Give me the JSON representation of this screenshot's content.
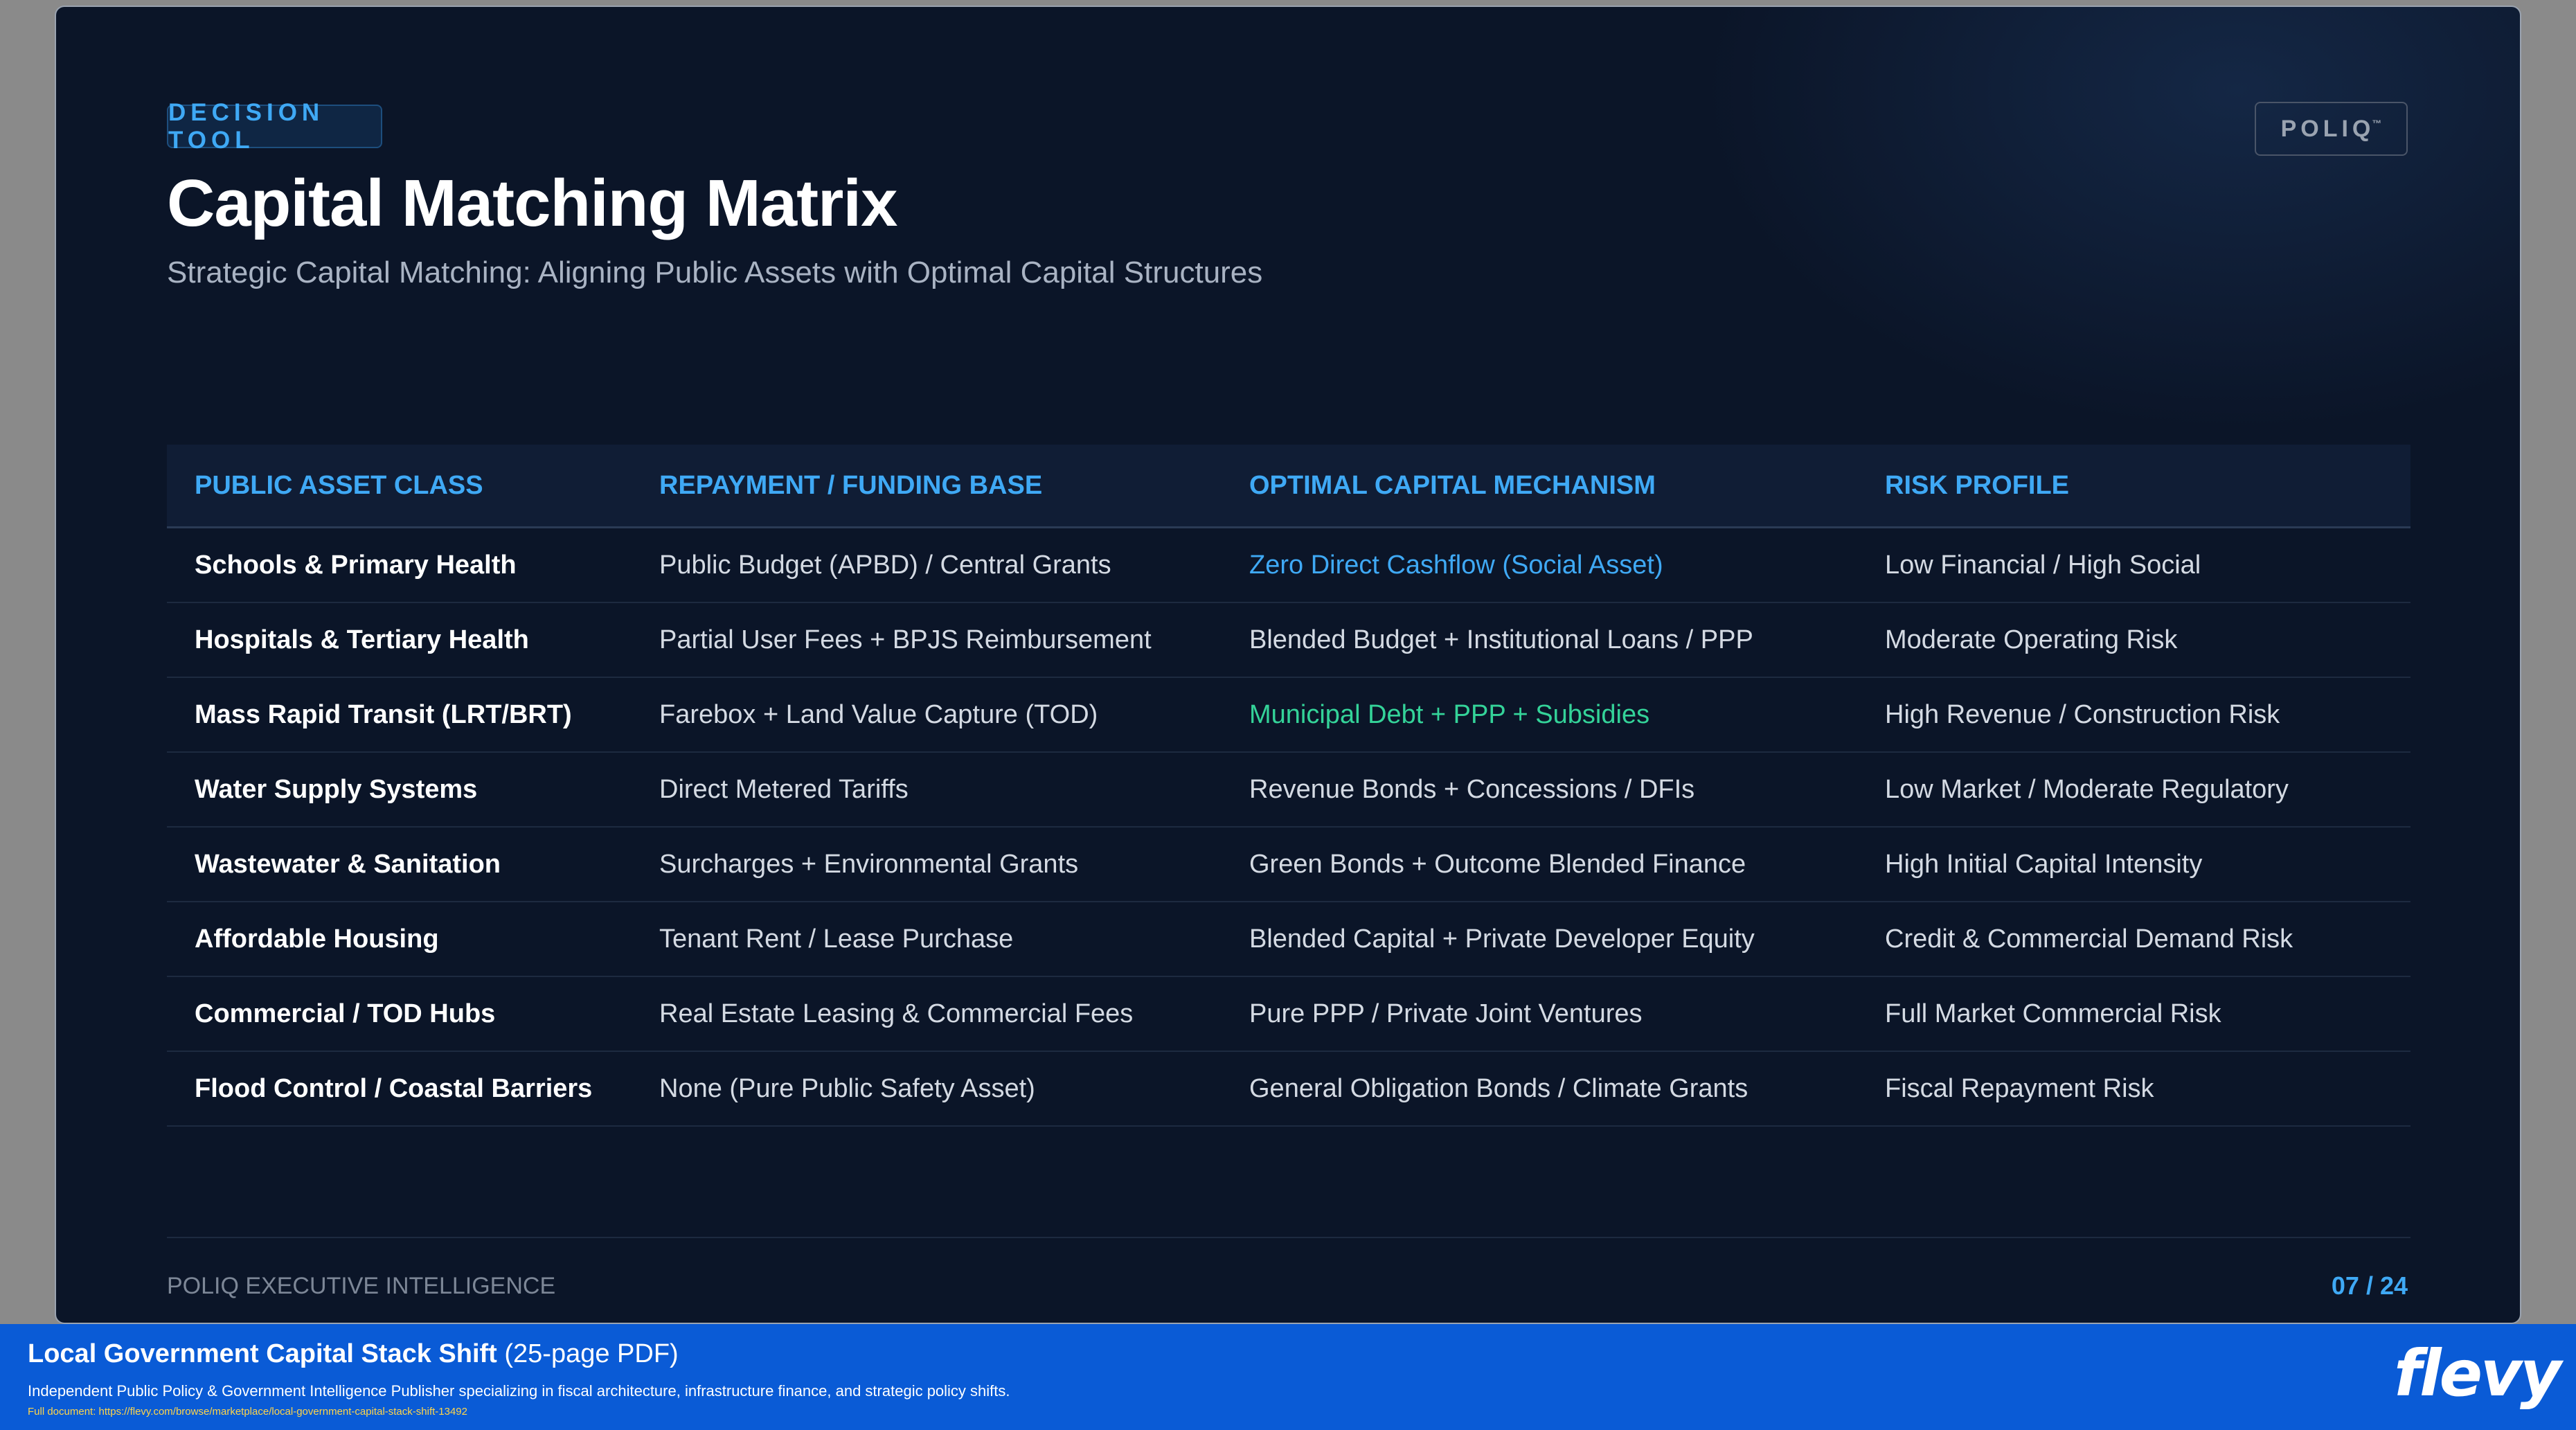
{
  "badge": "DECISION TOOL",
  "title": "Capital Matching Matrix",
  "subtitle": "Strategic Capital Matching: Aligning Public Assets with Optimal Capital Structures",
  "logo": "POLIQ",
  "logo_mark": "™",
  "table": {
    "headers": [
      "PUBLIC ASSET CLASS",
      "REPAYMENT / FUNDING BASE",
      "OPTIMAL CAPITAL MECHANISM",
      "RISK PROFILE"
    ],
    "rows": [
      [
        "Schools & Primary Health",
        "Public Budget (APBD) / Central Grants",
        "Zero Direct Cashflow (Social Asset)",
        "Low Financial / High Social"
      ],
      [
        "Hospitals & Tertiary Health",
        "Partial User Fees + BPJS Reimbursement",
        "Blended Budget + Institutional Loans / PPP",
        "Moderate Operating Risk"
      ],
      [
        "Mass Rapid Transit (LRT/BRT)",
        "Farebox + Land Value Capture (TOD)",
        "Municipal Debt + PPP + Subsidies",
        "High Revenue / Construction Risk"
      ],
      [
        "Water Supply Systems",
        "Direct Metered Tariffs",
        "Revenue Bonds + Concessions / DFIs",
        "Low Market / Moderate Regulatory"
      ],
      [
        "Wastewater & Sanitation",
        "Surcharges + Environmental Grants",
        "Green Bonds + Outcome Blended Finance",
        "High Initial Capital Intensity"
      ],
      [
        "Affordable Housing",
        "Tenant Rent / Lease Purchase",
        "Blended Capital + Private Developer Equity",
        "Credit & Commercial Demand Risk"
      ],
      [
        "Commercial / TOD Hubs",
        "Real Estate Leasing & Commercial Fees",
        "Pure PPP / Private Joint Ventures",
        "Full Market Commercial Risk"
      ],
      [
        "Flood Control / Coastal Barriers",
        "None (Pure Public Safety Asset)",
        "General Obligation Bonds / Climate Grants",
        "Fiscal Repayment Risk"
      ]
    ]
  },
  "footer": {
    "left": "POLIQ EXECUTIVE INTELLIGENCE",
    "page": "07 / 24"
  },
  "banner": {
    "title": "Local Government Capital Stack Shift",
    "title_suffix": " (25-page PDF)",
    "description": "Independent Public Policy & Government Intelligence Publisher specializing in fiscal architecture, infrastructure finance, and strategic policy shifts.",
    "link": "Full document: https://flevy.com/browse/marketplace/local-government-capital-stack-shift-13492",
    "brand": "flevy"
  },
  "colors": {
    "accent_blue": "#3fa9f5",
    "accent_green": "#34d399",
    "slide_bg": "#0b1528",
    "banner_bg": "#0a5bd6"
  }
}
